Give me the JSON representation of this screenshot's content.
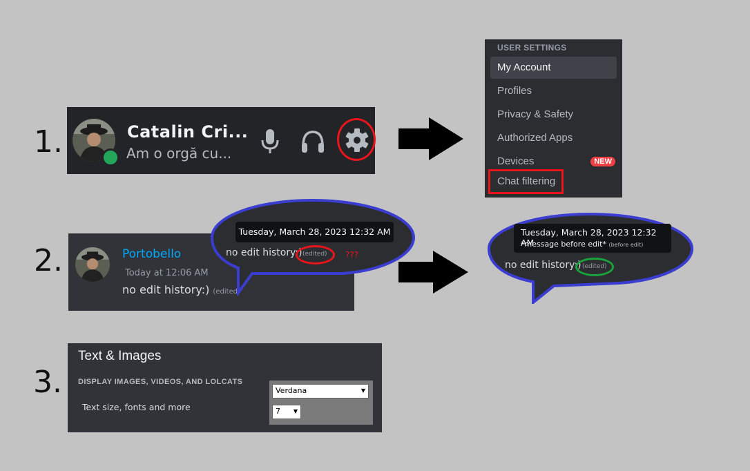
{
  "steps": [
    "1.",
    "2.",
    "3."
  ],
  "user_panel": {
    "username": "Catalin Cri...",
    "custom_status": "Am o orgă cu...",
    "icons": [
      "microphone-icon",
      "headphones-icon",
      "gear-icon"
    ]
  },
  "settings_menu": {
    "header": "USER SETTINGS",
    "items": [
      {
        "label": "My Account",
        "active": true
      },
      {
        "label": "Profiles"
      },
      {
        "label": "Privacy & Safety"
      },
      {
        "label": "Authorized Apps"
      },
      {
        "label": "Devices"
      },
      {
        "label": "Chat filtering"
      }
    ],
    "badge": "NEW"
  },
  "message": {
    "author": "Portobello",
    "timestamp": "Today at 12:06 AM",
    "text": "no edit history:)",
    "edited": "(edited)"
  },
  "bubble_before": {
    "tooltip": "Tuesday, March 28, 2023 12:32 AM",
    "text": "no edit history:)",
    "edited": "(edited)",
    "question": "???"
  },
  "bubble_after": {
    "tooltip": "Tuesday, March 28, 2023 12:32 AM",
    "tooltip_line2": "*message before edit*",
    "tooltip_line2_tag": "(before edit)",
    "text": "no edit history:)",
    "edited": "(edited)"
  },
  "text_images": {
    "title": "Text & Images",
    "section": "DISPLAY IMAGES, VIDEOS, AND LOLCATS",
    "description": "Text size, fonts and more",
    "font_select": "Verdana",
    "size_select": "7"
  },
  "colors": {
    "background": "#c3c3c3",
    "discord_dark": "#2b2d31",
    "highlight_red": "#e8151b",
    "highlight_green": "#1aa33a",
    "bubble_blue": "#3b3dd0",
    "link_blue": "#00a8fc"
  }
}
